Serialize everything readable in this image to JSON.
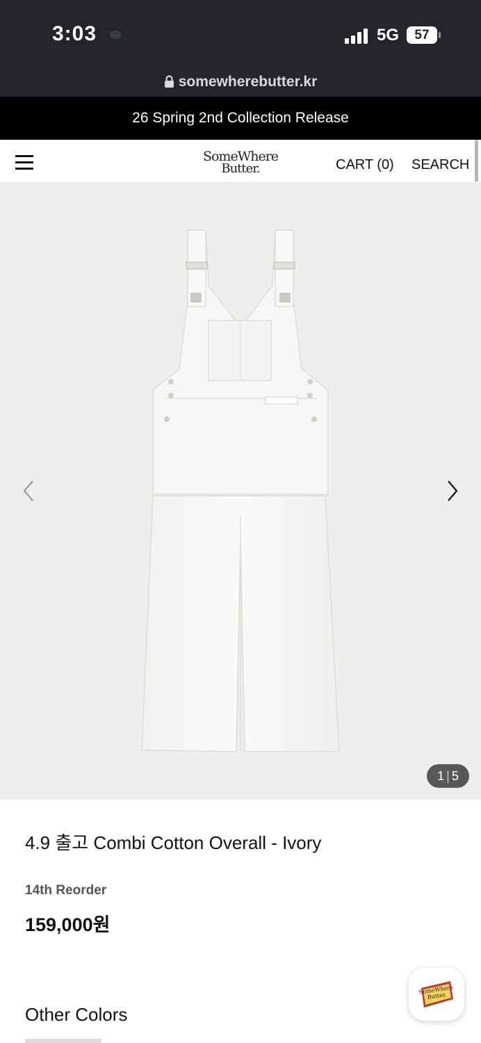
{
  "status_bar": {
    "time": "3:03",
    "network": "5G",
    "battery": "57"
  },
  "browser": {
    "url": "somewherebutter.kr"
  },
  "announcement": {
    "text": "26 Spring 2nd Collection Release"
  },
  "header": {
    "logo_line1": "SomeWhere",
    "logo_line2": "Butter.",
    "cart_label": "CART (0)",
    "search_label": "SEARCH"
  },
  "gallery": {
    "current": "1",
    "total": "5",
    "icons": [
      "chevron-left-icon",
      "chevron-right-icon"
    ]
  },
  "product": {
    "title": "4.9 출고 Combi Cotton Overall - Ivory",
    "reorder": "14th Reorder",
    "price": "159,000원",
    "other_colors_heading": "Other Colors"
  },
  "chat_badge": {
    "line1": "SomeWhere",
    "line2": "Butter."
  },
  "colors": {
    "status_bg": "#23252a",
    "announce_bg": "#000000",
    "gallery_bg": "#eeeeed",
    "badge_red": "#c0392b",
    "badge_yellow": "#f4d35e"
  }
}
